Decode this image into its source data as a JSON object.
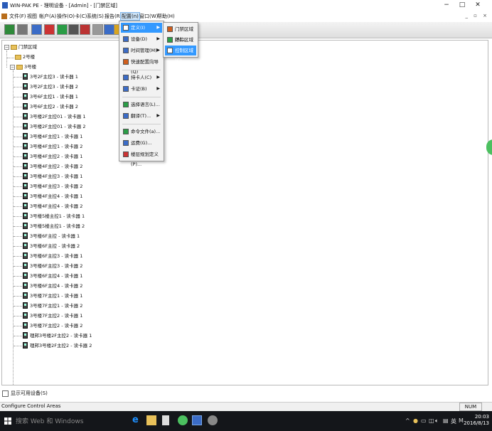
{
  "window": {
    "title": "WIN-PAK PE - 理明设备 - [Admin] - [门禁区域]",
    "minimize": "−",
    "restore": "□",
    "close": "✕",
    "mdi_controls": "_ ▫ ×"
  },
  "menubar": [
    {
      "id": "file",
      "label": "文件(F)"
    },
    {
      "id": "view",
      "label": "视图"
    },
    {
      "id": "account",
      "label": "帐户(A)"
    },
    {
      "id": "operate",
      "label": "操作(O)"
    },
    {
      "id": "card",
      "label": "卡(C)"
    },
    {
      "id": "system",
      "label": "系统(S)"
    },
    {
      "id": "report",
      "label": "报告(R)"
    },
    {
      "id": "config",
      "label": "配置(n)"
    },
    {
      "id": "window",
      "label": "窗口(W)"
    },
    {
      "id": "help",
      "label": "帮助(H)"
    }
  ],
  "tree": {
    "root": "门禁区域",
    "groups": [
      "2号楼",
      "3号楼"
    ],
    "devices": [
      "3号2F主控3 - 读卡器 1",
      "3号2F主控3 - 读卡器 2",
      "3号6F主控1 - 读卡器 1",
      "3号6F主控2 - 读卡器 2",
      "3号楼2F主控01 - 读卡器 1",
      "3号楼2F主控01 - 读卡器 2",
      "3号楼4F主控1 - 读卡器 1",
      "3号楼4F主控1 - 读卡器 2",
      "3号楼4F主控2 - 读卡器 1",
      "3号楼4F主控2 - 读卡器 2",
      "3号楼4F主控3 - 读卡器 1",
      "3号楼4F主控3 - 读卡器 2",
      "3号楼4F主控4 - 读卡器 1",
      "3号楼4F主控4 - 读卡器 2",
      "3号楼5楼主控1 - 读卡器 1",
      "3号楼5楼主控1 - 读卡器 2",
      "3号楼6F主控 - 读卡器 1",
      "3号楼6F主控 - 读卡器 2",
      "3号楼6F主控3 - 读卡器 1",
      "3号楼6F主控3 - 读卡器 2",
      "3号楼6F主控4 - 读卡器 1",
      "3号楼6F主控4 - 读卡器 2",
      "3号楼7F主控1 - 读卡器 1",
      "3号楼7F主控1 - 读卡器 2",
      "3号楼7F主控2 - 读卡器 1",
      "3号楼7F主控2 - 读卡器 2",
      "理邦3号楼2F主控2 - 读卡器 1",
      "理邦3号楼2F主控2 - 读卡器 2"
    ]
  },
  "config_menu": [
    {
      "label": "定义(I)",
      "submenu": true,
      "highlight": true
    },
    {
      "label": "设备(D)",
      "submenu": true
    },
    {
      "label": "时间管理(M)",
      "submenu": true
    },
    {
      "label": "快速配置向导(Q)",
      "submenu": false
    },
    {
      "label": "持卡人(C)",
      "submenu": true
    },
    {
      "label": "卡证(B)",
      "submenu": true
    },
    {
      "label": "选择语言(L)...",
      "submenu": false
    },
    {
      "label": "翻译(T)...",
      "submenu": true
    },
    {
      "label": "命令文件(a)...",
      "submenu": false
    },
    {
      "label": "运费(G)...",
      "submenu": false
    },
    {
      "label": "楼层规划定义(P)...",
      "submenu": false
    }
  ],
  "define_submenu": [
    {
      "label": "门禁区域(A)...",
      "highlight": false
    },
    {
      "label": "跟踪区域(T)...",
      "highlight": false
    },
    {
      "label": "控制区域(C)...",
      "highlight": true
    }
  ],
  "checkbox_label": "显示可用设备(S)",
  "status": {
    "text": "Configure Control Areas",
    "num": "NUM"
  },
  "taskbar": {
    "search_placeholder": "搜索 Web 和 Windows",
    "time": "20:03",
    "date": "2016/8/13",
    "ime": "英",
    "tray": "^"
  },
  "colors": {
    "menu_highlight": "#3399ff",
    "taskbar": "#14161a"
  }
}
